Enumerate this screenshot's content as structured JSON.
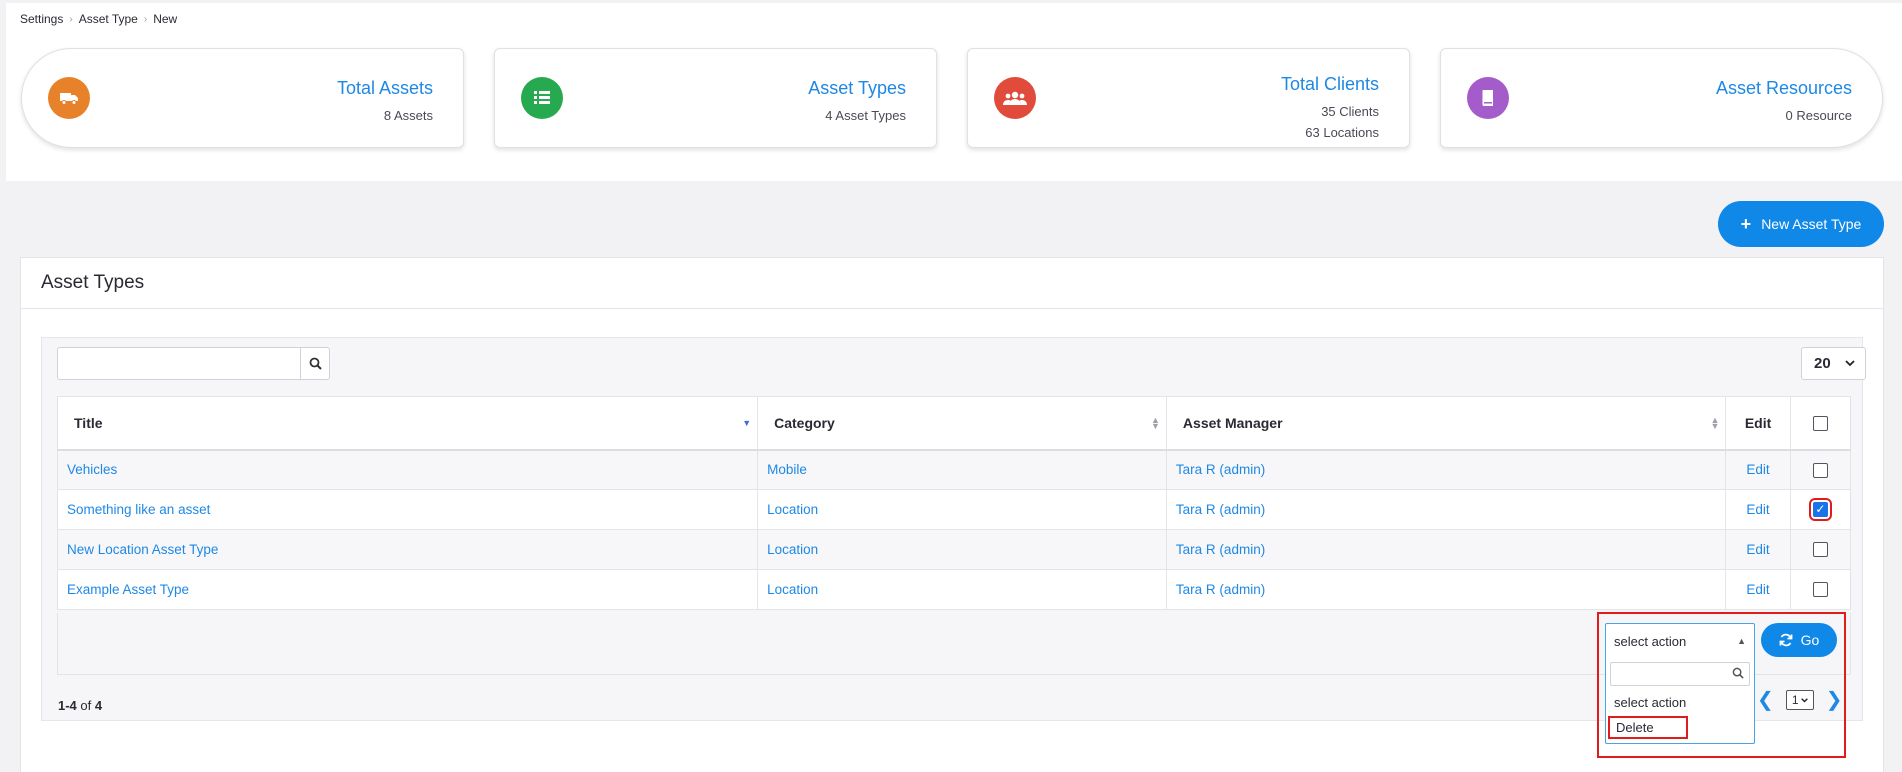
{
  "breadcrumb": [
    "Settings",
    "Asset Type",
    "New"
  ],
  "cards": [
    {
      "title": "Total Assets",
      "lines": [
        "8 Assets"
      ],
      "icon": "truck-icon",
      "color": "#e8822a"
    },
    {
      "title": "Asset Types",
      "lines": [
        "4 Asset Types"
      ],
      "icon": "list-icon",
      "color": "#27a94f"
    },
    {
      "title": "Total Clients",
      "lines": [
        "35 Clients",
        "63 Locations"
      ],
      "icon": "users-icon",
      "color": "#e04b3c"
    },
    {
      "title": "Asset Resources",
      "lines": [
        "0 Resource"
      ],
      "icon": "book-icon",
      "color": "#a35cc9"
    }
  ],
  "new_button_label": "New Asset Type",
  "panel_title": "Asset Types",
  "search": {
    "placeholder": "",
    "value": ""
  },
  "page_size": "20",
  "table": {
    "headers": {
      "title": "Title",
      "category": "Category",
      "manager": "Asset Manager",
      "edit": "Edit"
    },
    "rows": [
      {
        "title": "Vehicles",
        "category": "Mobile",
        "manager": "Tara R (admin)",
        "edit": "Edit",
        "checked": false
      },
      {
        "title": "Something like an asset",
        "category": "Location",
        "manager": "Tara R (admin)",
        "edit": "Edit",
        "checked": true
      },
      {
        "title": "New Location Asset Type",
        "category": "Location",
        "manager": "Tara R (admin)",
        "edit": "Edit",
        "checked": false
      },
      {
        "title": "Example Asset Type",
        "category": "Location",
        "manager": "Tara R (admin)",
        "edit": "Edit",
        "checked": false
      }
    ]
  },
  "count": {
    "range": "1-4",
    "of": "of",
    "total": "4"
  },
  "action_select": {
    "current": "select action",
    "options": [
      "select action",
      "Delete"
    ]
  },
  "go_label": "Go",
  "pager": {
    "current": "1"
  }
}
